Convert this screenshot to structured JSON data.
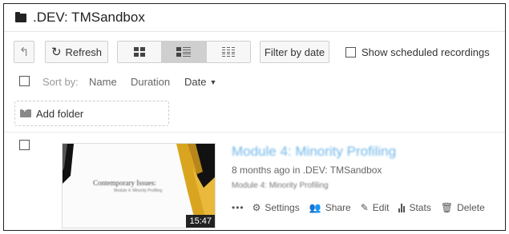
{
  "header": {
    "title": ".DEV: TMSandbox",
    "folder_icon": "folder-icon"
  },
  "toolbar": {
    "up_icon": "↰",
    "refresh_label": "Refresh",
    "refresh_icon": "↻",
    "view_modes": [
      "thumbnail-grid",
      "detail-list",
      "compact-list"
    ],
    "active_view": "detail-list",
    "filter_label": "Filter by date",
    "scheduled_label": "Show scheduled recordings",
    "scheduled_checked": false
  },
  "sort": {
    "label": "Sort by:",
    "name": "Name",
    "duration": "Duration",
    "date": "Date",
    "active": "Date",
    "direction": "descending"
  },
  "add_folder": {
    "label": "Add folder"
  },
  "sessions": [
    {
      "title": "Module 4: Minority Profiling",
      "meta": "8 months ago in .DEV: TMSandbox",
      "description": "Module 4: Minority Profiling",
      "duration": "15:47",
      "thumb_title": "Contemporary Issues:",
      "thumb_subtitle": "Module 4: Minority Profiling",
      "more_label": "•••",
      "actions": {
        "settings": "Settings",
        "share": "Share",
        "edit": "Edit",
        "stats": "Stats",
        "delete": "Delete"
      }
    }
  ],
  "colors": {
    "accent": "#6fb6e8",
    "thumb_gold": "#d9a520",
    "thumb_dark": "#111111"
  }
}
